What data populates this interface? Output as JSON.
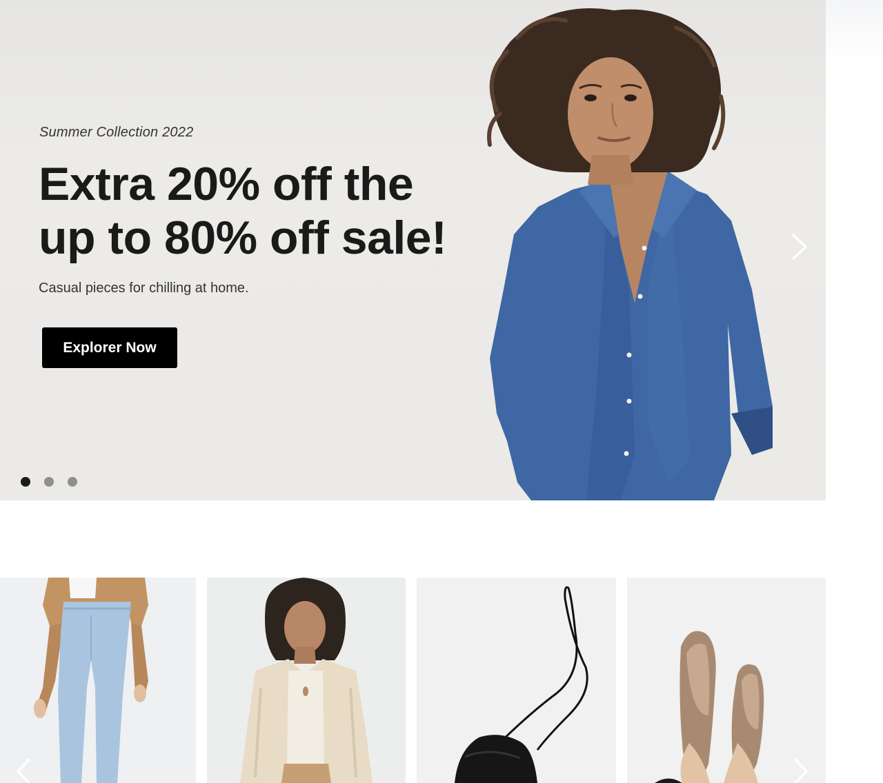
{
  "hero": {
    "eyebrow": "Summer Collection 2022",
    "title_line1": "Extra 20% off the",
    "title_line2": "up to 80% off sale!",
    "subtitle": "Casual pieces for chilling at home.",
    "cta_label": "Explorer Now",
    "slide_count": 3,
    "active_slide": 1,
    "next_icon": "chevron-right-icon"
  },
  "products": {
    "prev_icon": "chevron-left-icon",
    "next_icon": "chevron-right-icon",
    "items": [
      {
        "image": "model-in-light-jeans-and-suede-jacket"
      },
      {
        "image": "model-in-linen-shirt-and-cream-top"
      },
      {
        "image": "black-leather-pouch-bag"
      },
      {
        "image": "tan-ballet-flats"
      }
    ]
  },
  "colors": {
    "hero_bg": "#ebeae7",
    "cta_bg": "#000000",
    "cta_text": "#ffffff",
    "text_dark": "#1a1a1a",
    "denim": "#3e67a3"
  }
}
